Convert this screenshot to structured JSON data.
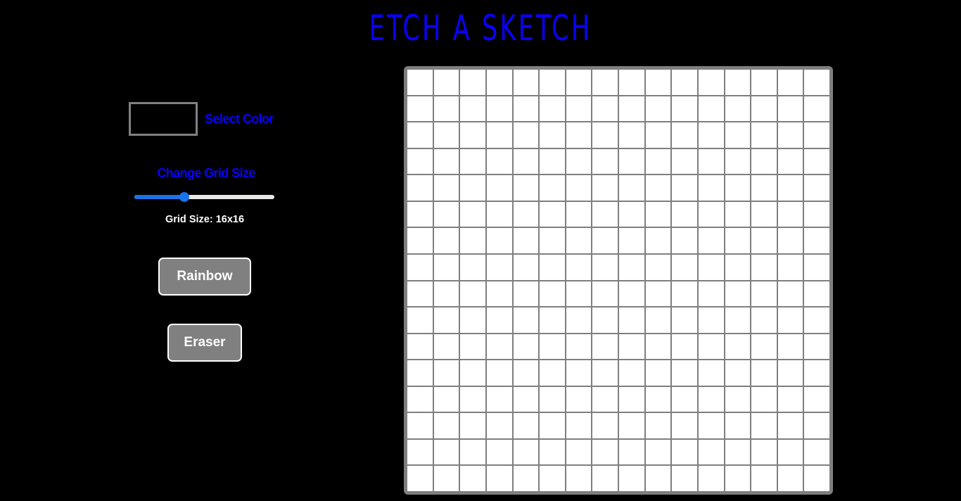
{
  "header": {
    "title": "ETCH A SKETCH"
  },
  "controls": {
    "color_label": "Select Color",
    "selected_color": "#000000",
    "grid_size_label": "Change Grid Size",
    "slider": {
      "min": 1,
      "max": 64,
      "value": 16
    },
    "grid_size_text": "Grid Size: 16x16",
    "rainbow_label": "Rainbow",
    "eraser_label": "Eraser"
  },
  "board": {
    "rows": 16,
    "cols": 16,
    "cell_color": "#ffffff",
    "border_color": "#7f7f7f"
  },
  "colors": {
    "accent": "#0a00ff",
    "slider": "#1a73e8",
    "button_bg": "#808080"
  }
}
